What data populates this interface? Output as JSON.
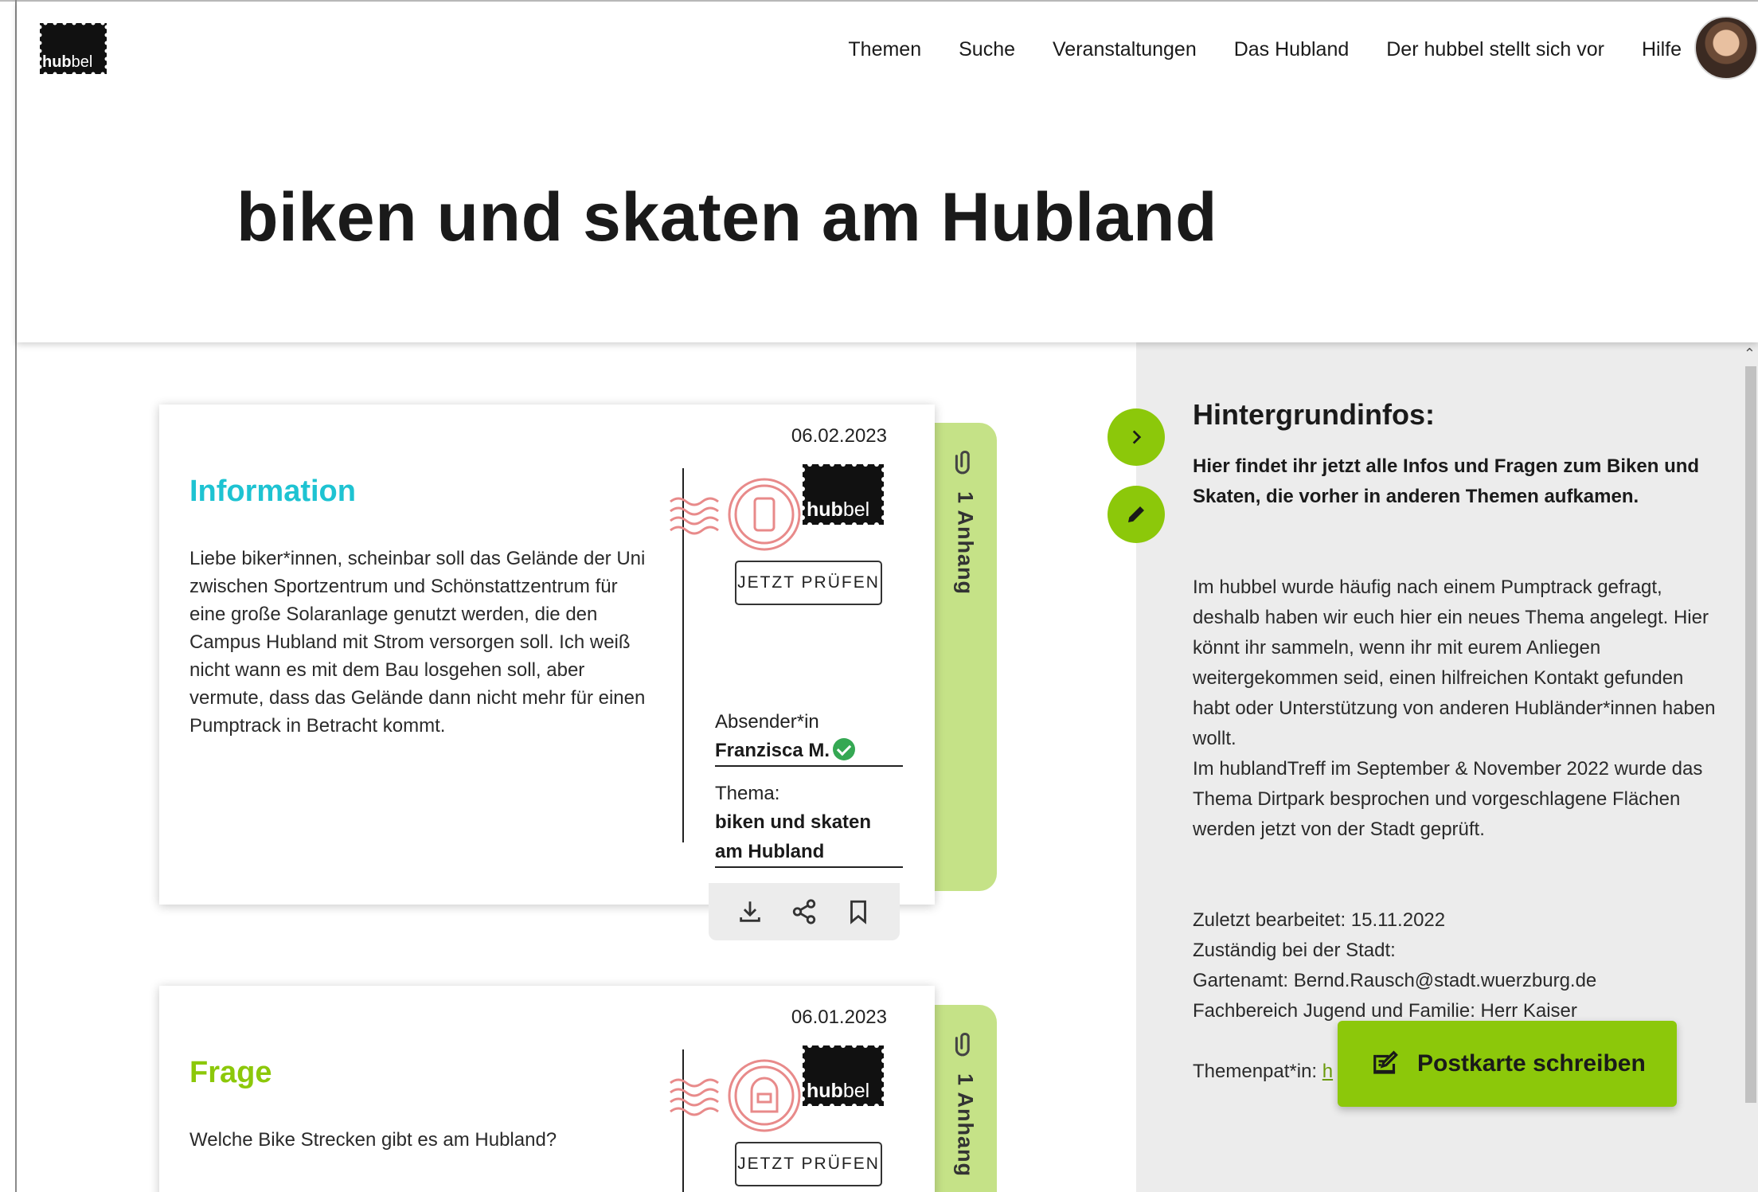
{
  "header": {
    "logo_text": "hubbel",
    "nav": [
      "Themen",
      "Suche",
      "Veranstaltungen",
      "Das Hubland",
      "Der hubbel stellt sich vor",
      "Hilfe"
    ],
    "page_title": "biken und skaten am Hubland"
  },
  "cards": [
    {
      "kind": "Information",
      "kind_color": "#1ec3d2",
      "date": "06.02.2023",
      "body": "Liebe biker*innen, scheinbar soll das Gelände der Uni zwischen Sportzentrum und Schönstattzentrum für eine große Solaranlage genutzt werden, die den Campus Hubland mit Strom versorgen soll. Ich weiß nicht wann es mit dem Bau losgehen soll, aber vermute, dass das Gelände dann nicht mehr für einen Pumptrack in Betracht kommt.",
      "check_label": "JETZT PRÜFEN",
      "sender_label": "Absender*in",
      "sender": "Franzisca M.",
      "topic_label": "Thema:",
      "topic": "biken und skaten am Hubland",
      "attachment": "1 Anhang",
      "stamp_text": "hubbel",
      "stamp_icon": "phone-icon"
    },
    {
      "kind": "Frage",
      "kind_color": "#8cc80a",
      "date": "06.01.2023",
      "body": "Welche Bike Strecken gibt es am Hubland?",
      "check_label": "JETZT PRÜFEN",
      "attachment": "1 Anhang",
      "stamp_text": "hubbel",
      "stamp_icon": "mailbox-icon"
    }
  ],
  "sidebar": {
    "title": "Hintergrundinfos:",
    "intro": "Hier findet ihr jetzt alle Infos und Fragen zum Biken und Skaten, die vorher in anderen Themen aufkamen.",
    "p1": "Im hubbel wurde häufig nach einem Pumptrack gefragt, deshalb haben wir euch hier ein neues Thema angelegt. Hier könnt ihr sammeln, wenn ihr mit eurem Anliegen weitergekommen seid, einen hilfreichen Kontakt gefunden habt oder Unterstützung von anderen Hubländer*innen haben wollt.",
    "p2": "Im hublandTreff im September & November 2022 wurde das Thema Dirtpark besprochen und vorgeschlagene Flächen werden jetzt von der Stadt geprüft.",
    "edited": "Zuletzt bearbeitet: 15.11.2022",
    "responsible_label": "Zuständig bei der Stadt:",
    "contact1": "Gartenamt: Bernd.Rausch@stadt.wuerzburg.de",
    "contact2": "Fachbereich Jugend und Familie: Herr Kaiser",
    "patron_label": "Themenpat*in: ",
    "patron_link": "h"
  },
  "fab_label": "Postkarte schreiben",
  "colors": {
    "accent_green": "#8cc80a",
    "tab_green": "#c5e287",
    "info_cyan": "#1ec3d2",
    "stamp_red": "#e88a8a"
  }
}
